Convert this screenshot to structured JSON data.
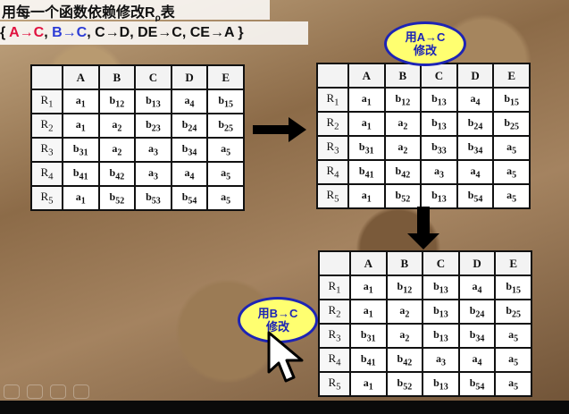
{
  "title": {
    "main": "用每一个函数依赖修改R",
    "sub": "ρ",
    "suffix": "表"
  },
  "dependencies": {
    "open": "{ ",
    "d1": "A→C",
    "sep1": ", ",
    "d2": "B→C",
    "sep2": ", ",
    "rest": "C→D, DE→C, CE→A }",
    "d1_color": "#e0123f",
    "d2_color": "#2c3cd6"
  },
  "columns": [
    "A",
    "B",
    "C",
    "D",
    "E"
  ],
  "row_labels": [
    "R1",
    "R2",
    "R3",
    "R4",
    "R5"
  ],
  "table1": [
    [
      "a1",
      "b12",
      "b13",
      "a4",
      "b15"
    ],
    [
      "a1",
      "a2",
      "b23",
      "b24",
      "b25"
    ],
    [
      "b31",
      "a2",
      "a3",
      "b34",
      "a5"
    ],
    [
      "b41",
      "b42",
      "a3",
      "a4",
      "a5"
    ],
    [
      "a1",
      "b52",
      "b53",
      "b54",
      "a5"
    ]
  ],
  "table2": [
    [
      "a1",
      "b12",
      "b13",
      "a4",
      "b15"
    ],
    [
      "a1",
      "a2",
      "b13",
      "b24",
      "b25"
    ],
    [
      "b31",
      "a2",
      "b33",
      "b34",
      "a5"
    ],
    [
      "b41",
      "b42",
      "a3",
      "a4",
      "a5"
    ],
    [
      "a1",
      "b52",
      "b13",
      "b54",
      "a5"
    ]
  ],
  "table3": [
    [
      "a1",
      "b12",
      "b13",
      "a4",
      "b15"
    ],
    [
      "a1",
      "a2",
      "b13",
      "b24",
      "b25"
    ],
    [
      "b31",
      "a2",
      "b13",
      "b34",
      "a5"
    ],
    [
      "b41",
      "b42",
      "a3",
      "a4",
      "a5"
    ],
    [
      "a1",
      "b52",
      "b13",
      "b54",
      "a5"
    ]
  ],
  "badge1": {
    "line1": "用A→C",
    "line2": "修改"
  },
  "badge2": {
    "line1": "用B→C",
    "line2": "修改"
  }
}
